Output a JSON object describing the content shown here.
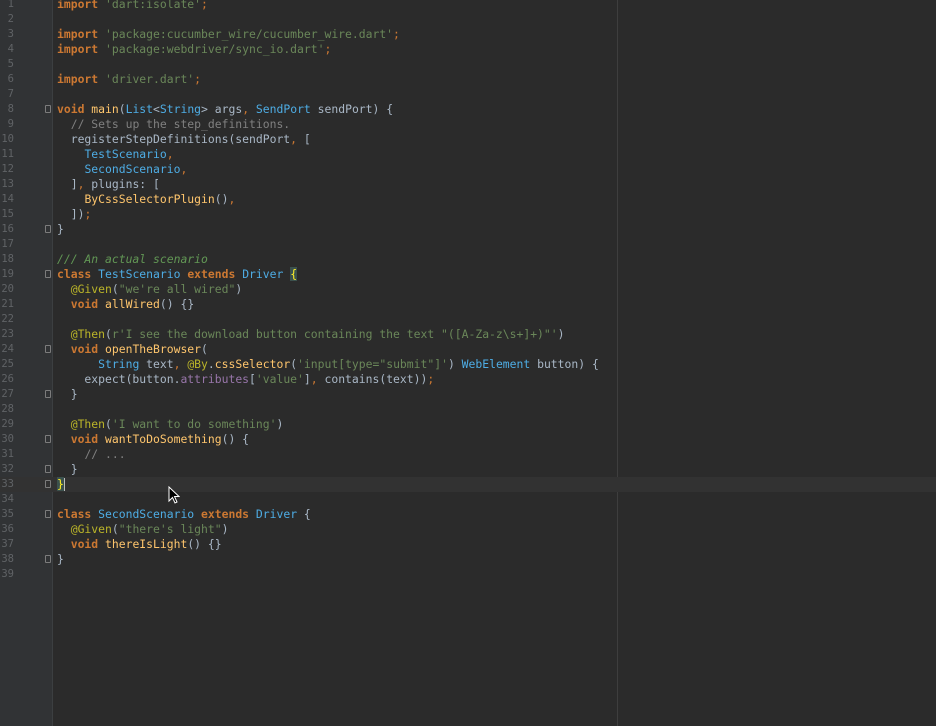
{
  "editor": {
    "lines": [
      {
        "n": "1",
        "segs": [
          [
            "kw",
            "import"
          ],
          [
            "",
            " "
          ],
          [
            "str",
            "'dart:isolate'"
          ],
          [
            "punc",
            ";"
          ]
        ]
      },
      {
        "n": "2",
        "segs": []
      },
      {
        "n": "3",
        "segs": [
          [
            "kw",
            "import"
          ],
          [
            "",
            " "
          ],
          [
            "str",
            "'package:cucumber_wire/cucumber_wire.dart'"
          ],
          [
            "punc",
            ";"
          ]
        ]
      },
      {
        "n": "4",
        "segs": [
          [
            "kw",
            "import"
          ],
          [
            "",
            " "
          ],
          [
            "str",
            "'package:webdriver/sync_io.dart'"
          ],
          [
            "punc",
            ";"
          ]
        ]
      },
      {
        "n": "5",
        "segs": []
      },
      {
        "n": "6",
        "segs": [
          [
            "kw",
            "import"
          ],
          [
            "",
            " "
          ],
          [
            "str",
            "'driver.dart'"
          ],
          [
            "punc",
            ";"
          ]
        ]
      },
      {
        "n": "7",
        "segs": []
      },
      {
        "n": "8",
        "segs": [
          [
            "kw",
            "void"
          ],
          [
            "",
            " "
          ],
          [
            "fn",
            "main"
          ],
          [
            "",
            "("
          ],
          [
            "ty",
            "List"
          ],
          [
            "",
            "<"
          ],
          [
            "ty",
            "String"
          ],
          [
            "",
            "> args"
          ],
          [
            "punc",
            ","
          ],
          [
            "",
            " "
          ],
          [
            "ty",
            "SendPort"
          ],
          [
            "",
            " sendPort) {"
          ]
        ]
      },
      {
        "n": "9",
        "segs": [
          [
            "",
            "  "
          ],
          [
            "cm",
            "// Sets up the step_definitions."
          ]
        ]
      },
      {
        "n": "10",
        "segs": [
          [
            "",
            "  registerStepDefinitions(sendPort"
          ],
          [
            "punc",
            ","
          ],
          [
            "",
            " ["
          ]
        ]
      },
      {
        "n": "11",
        "segs": [
          [
            "",
            "    "
          ],
          [
            "ty",
            "TestScenario"
          ],
          [
            "punc",
            ","
          ]
        ]
      },
      {
        "n": "12",
        "segs": [
          [
            "",
            "    "
          ],
          [
            "ty",
            "SecondScenario"
          ],
          [
            "punc",
            ","
          ]
        ]
      },
      {
        "n": "13",
        "segs": [
          [
            "",
            "  ]"
          ],
          [
            "punc",
            ","
          ],
          [
            "",
            " plugins: ["
          ]
        ]
      },
      {
        "n": "14",
        "segs": [
          [
            "",
            "    "
          ],
          [
            "fn",
            "ByCssSelectorPlugin"
          ],
          [
            "",
            "()"
          ],
          [
            "punc",
            ","
          ]
        ]
      },
      {
        "n": "15",
        "segs": [
          [
            "",
            "  ])"
          ],
          [
            "punc",
            ";"
          ]
        ]
      },
      {
        "n": "16",
        "segs": [
          [
            "",
            "}"
          ]
        ]
      },
      {
        "n": "17",
        "segs": []
      },
      {
        "n": "18",
        "segs": [
          [
            "doc",
            "/// An actual scenario"
          ]
        ]
      },
      {
        "n": "19",
        "segs": [
          [
            "kw",
            "class"
          ],
          [
            "",
            " "
          ],
          [
            "ty",
            "TestScenario"
          ],
          [
            "",
            " "
          ],
          [
            "kw",
            "extends"
          ],
          [
            "",
            " "
          ],
          [
            "ty",
            "Driver"
          ],
          [
            "",
            " "
          ],
          [
            "brace",
            "{"
          ]
        ]
      },
      {
        "n": "20",
        "segs": [
          [
            "",
            "  "
          ],
          [
            "ann",
            "@Given"
          ],
          [
            "",
            "("
          ],
          [
            "str",
            "\"we're all wired\""
          ],
          [
            "",
            ")"
          ]
        ]
      },
      {
        "n": "21",
        "segs": [
          [
            "",
            "  "
          ],
          [
            "kw",
            "void"
          ],
          [
            "",
            " "
          ],
          [
            "fn",
            "allWired"
          ],
          [
            "",
            "() {}"
          ]
        ]
      },
      {
        "n": "22",
        "segs": []
      },
      {
        "n": "23",
        "segs": [
          [
            "",
            "  "
          ],
          [
            "ann",
            "@Then"
          ],
          [
            "",
            "("
          ],
          [
            "str",
            "r'I see the download button containing the text \"([A-Za-z\\s+]+)\"'"
          ],
          [
            "",
            ")"
          ]
        ]
      },
      {
        "n": "24",
        "segs": [
          [
            "",
            "  "
          ],
          [
            "kw",
            "void"
          ],
          [
            "",
            " "
          ],
          [
            "fn",
            "openTheBrowser"
          ],
          [
            "",
            "("
          ]
        ]
      },
      {
        "n": "25",
        "segs": [
          [
            "",
            "      "
          ],
          [
            "ty",
            "String"
          ],
          [
            "",
            " text"
          ],
          [
            "punc",
            ","
          ],
          [
            "",
            " "
          ],
          [
            "ann",
            "@By"
          ],
          [
            "",
            "."
          ],
          [
            "fn",
            "cssSelector"
          ],
          [
            "",
            "("
          ],
          [
            "str",
            "'input[type=\"submit\"]'"
          ],
          [
            "",
            ") "
          ],
          [
            "ty",
            "WebElement"
          ],
          [
            "",
            " button) {"
          ]
        ]
      },
      {
        "n": "26",
        "segs": [
          [
            "",
            "    expect(button."
          ],
          [
            "fld",
            "attributes"
          ],
          [
            "",
            "["
          ],
          [
            "str",
            "'value'"
          ],
          [
            "",
            "]"
          ],
          [
            "punc",
            ","
          ],
          [
            "",
            " contains(text))"
          ],
          [
            "punc",
            ";"
          ]
        ]
      },
      {
        "n": "27",
        "segs": [
          [
            "",
            "  }"
          ]
        ]
      },
      {
        "n": "28",
        "segs": []
      },
      {
        "n": "29",
        "segs": [
          [
            "",
            "  "
          ],
          [
            "ann",
            "@Then"
          ],
          [
            "",
            "("
          ],
          [
            "str",
            "'I want to do something'"
          ],
          [
            "",
            ")"
          ]
        ]
      },
      {
        "n": "30",
        "segs": [
          [
            "",
            "  "
          ],
          [
            "kw",
            "void"
          ],
          [
            "",
            " "
          ],
          [
            "fn",
            "wantToDoSomething"
          ],
          [
            "",
            "() {"
          ]
        ]
      },
      {
        "n": "31",
        "segs": [
          [
            "",
            "    "
          ],
          [
            "cm",
            "// ..."
          ]
        ]
      },
      {
        "n": "32",
        "segs": [
          [
            "",
            "  }"
          ]
        ]
      },
      {
        "n": "33",
        "segs": [
          [
            "brace",
            "}"
          ],
          [
            "caret",
            ""
          ]
        ]
      },
      {
        "n": "34",
        "segs": []
      },
      {
        "n": "35",
        "segs": [
          [
            "kw",
            "class"
          ],
          [
            "",
            " "
          ],
          [
            "ty",
            "SecondScenario"
          ],
          [
            "",
            " "
          ],
          [
            "kw",
            "extends"
          ],
          [
            "",
            " "
          ],
          [
            "ty",
            "Driver"
          ],
          [
            "",
            " {"
          ]
        ]
      },
      {
        "n": "36",
        "segs": [
          [
            "",
            "  "
          ],
          [
            "ann",
            "@Given"
          ],
          [
            "",
            "("
          ],
          [
            "str",
            "\"there's light\""
          ],
          [
            "",
            ")"
          ]
        ]
      },
      {
        "n": "37",
        "segs": [
          [
            "",
            "  "
          ],
          [
            "kw",
            "void"
          ],
          [
            "",
            " "
          ],
          [
            "fn",
            "thereIsLight"
          ],
          [
            "",
            "() {}"
          ]
        ]
      },
      {
        "n": "38",
        "segs": [
          [
            "",
            "}"
          ]
        ]
      },
      {
        "n": "39",
        "segs": []
      }
    ],
    "fold_markers": [
      "8",
      "16",
      "19",
      "24",
      "27",
      "30",
      "32",
      "33",
      "35",
      "38"
    ],
    "caret_line": "33",
    "colors": {
      "background": "#2b2b2b",
      "keyword": "#cc7832",
      "string": "#6a8759",
      "type": "#4eade5",
      "function": "#ffc66d",
      "annotation": "#bbb529",
      "comment": "#808080"
    }
  }
}
